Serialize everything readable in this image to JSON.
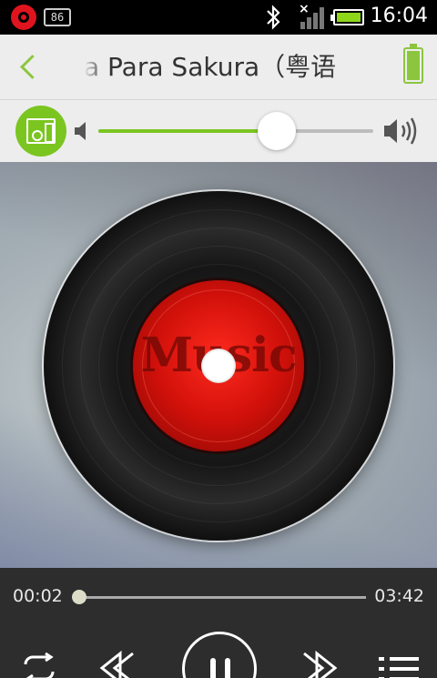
{
  "status_bar": {
    "notification_count": "86",
    "time": "16:04"
  },
  "header": {
    "song_title": "a Para Sakura（粤语"
  },
  "volume": {
    "level_fraction": 0.65
  },
  "artwork": {
    "label_text": "Music"
  },
  "player": {
    "current_time": "00:02",
    "total_time": "03:42",
    "progress_fraction": 0.01
  },
  "colors": {
    "accent": "#7bc520",
    "disc_label": "#d0100a",
    "controls_bg": "#2d2d2d"
  },
  "icons": [
    "beats-icon",
    "bluetooth-icon",
    "signal-icon",
    "battery-icon",
    "back-icon",
    "speaker-icon",
    "volume-low-icon",
    "volume-high-icon",
    "repeat-icon",
    "previous-icon",
    "pause-icon",
    "next-icon",
    "playlist-icon"
  ]
}
